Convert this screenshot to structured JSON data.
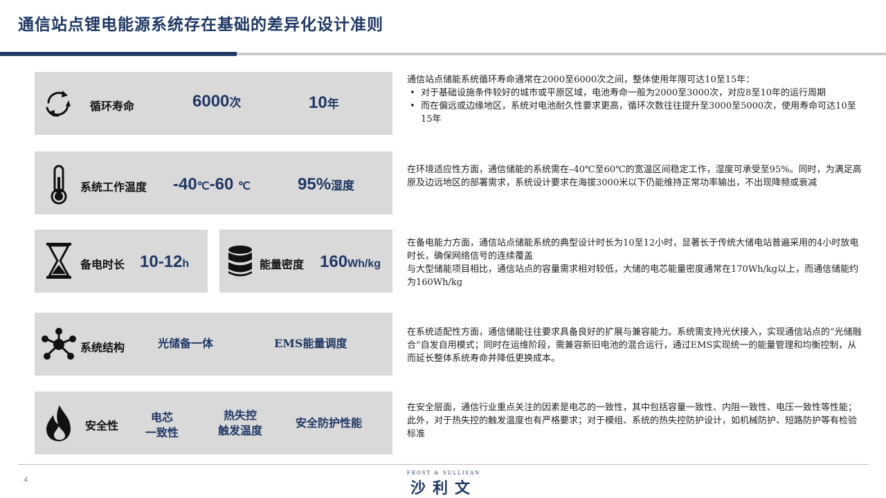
{
  "header": {
    "title": "通信站点锂电能源系统存在基础的差异化设计准则"
  },
  "rows": {
    "cycle": {
      "icon": "recycle-arrows-icon",
      "label": "循环寿命",
      "value1": "6000",
      "value1_unit": "次",
      "value2": "10",
      "value2_unit": "年",
      "desc_intro": "通信站点储能系统循环寿命通常在2000至6000次之间，整体使用年限可达10至15年：",
      "desc_bullets": [
        "对于基础设施条件较好的城市或平原区域，电池寿命一般为2000至3000次，对应8至10年的运行周期",
        "而在偏远或边缘地区，系统对电池耐久性要求更高，循环次数往往提升至3000至5000次，使用寿命可达10至15年"
      ]
    },
    "temperature": {
      "icon": "thermometer-icon",
      "label": "系统工作温度",
      "value1_a": "-40",
      "value1_unit_a": "℃",
      "value1_sep": "-",
      "value1_b": "60 ",
      "value1_unit_b": "℃",
      "value2": "95%",
      "value2_unit": "湿度",
      "desc": "在环境适应性方面，通信储能的系统需在–40℃至60℃的宽温区间稳定工作，湿度可承受至95%。同时，为满足高原及边远地区的部署需求，系统设计要求在海拔3000米以下仍能维持正常功率输出，不出现降频或衰减"
    },
    "backup": {
      "icon": "hourglass-icon",
      "label": "备电时长",
      "value": "10-12",
      "value_unit": "h"
    },
    "density": {
      "icon": "database-icon",
      "label": "能量密度",
      "value": "160",
      "value_unit": "Wh/kg",
      "desc_lines": [
        "在备电能力方面，通信站点储能系统的典型设计时长为10至12小时，显著长于传统大储电站普遍采用的4小时放电时长，确保网络信号的连续覆盖",
        "与大型储能项目相比，通信站点的容量需求相对较低，大储的电芯能量密度通常在170Wh/kg以上，而通信储能约为160Wh/kg"
      ]
    },
    "structure": {
      "icon": "network-nodes-icon",
      "label": "系统结构",
      "value1": "光储备一体",
      "value2": "EMS能量调度",
      "desc": "在系统适配性方面，通信储能往往要求具备良好的扩展与兼容能力。系统需支持光伏接入，实现通信站点的“光储融合”自发自用模式；同时在运维阶段，需兼容新旧电池的混合运行，通过EMS实现统一的能量管理和均衡控制，从而延长整体系统寿命并降低更换成本。"
    },
    "safety": {
      "icon": "flame-icon",
      "label": "安全性",
      "value1_l1": "电芯",
      "value1_l2": "一致性",
      "value2_l1": "热失控",
      "value2_l2": "触发温度",
      "value3": "安全防护性能",
      "desc": "在安全层面，通信行业重点关注的因素是电芯的一致性，其中包括容量一致性、内阻一致性、电压一致性等性能；此外，对于热失控的触发温度也有严格要求；对于模组、系统的热失控防护设计，如机械防护、短路防护等有检验标准"
    }
  },
  "footer": {
    "page_number": "4",
    "logo_en": "FROST & SULLIVAN",
    "logo_cn": "沙利文"
  },
  "colors": {
    "navy": "#1f3864",
    "panel": "#d9d9d9",
    "rule_gray": "#c9c9c9"
  }
}
